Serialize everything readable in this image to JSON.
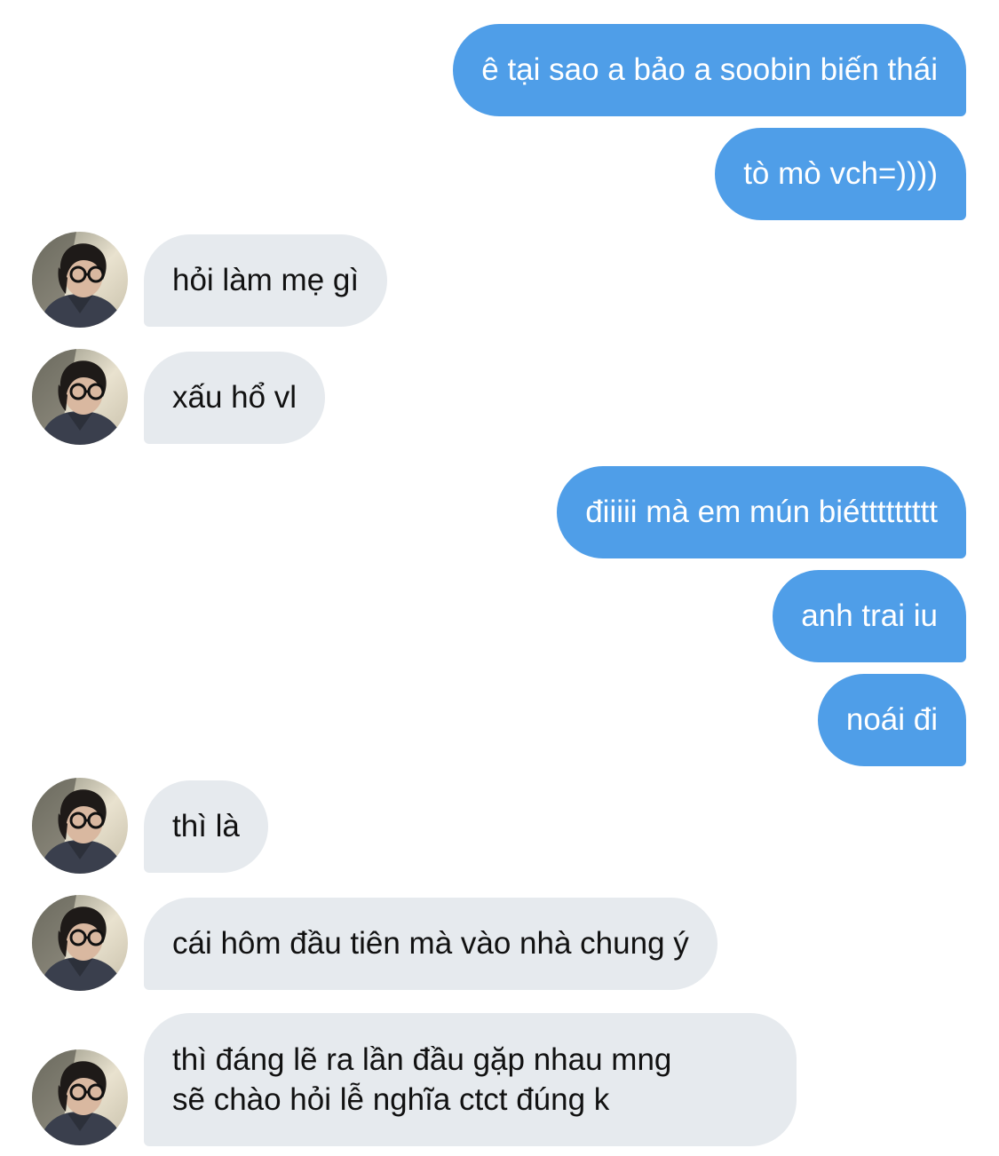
{
  "conversation": {
    "messages": [
      {
        "side": "sent",
        "text": "ê tại sao a bảo a soobin biến thái"
      },
      {
        "side": "sent",
        "text": "tò mò vch=))))"
      },
      {
        "side": "received",
        "text": "hỏi làm mẹ gì"
      },
      {
        "side": "received",
        "text": "xấu hổ vl"
      },
      {
        "side": "sent",
        "text": "điiiii mà em mún biéttttttttt"
      },
      {
        "side": "sent",
        "text": "anh trai iu"
      },
      {
        "side": "sent",
        "text": "noái đi"
      },
      {
        "side": "received",
        "text": "thì là"
      },
      {
        "side": "received",
        "text": "cái hôm đầu tiên mà vào nhà chung ý"
      },
      {
        "side": "received",
        "line1": "thì đáng lẽ ra lần đầu gặp nhau mng",
        "line2": "sẽ chào hỏi lễ nghĩa ctct đúng k"
      }
    ]
  },
  "colors": {
    "sent_bubble": "#4f9ee8",
    "received_bubble": "#e6eaee",
    "background": "#ffffff"
  },
  "icons": {
    "avatar": "contact-avatar-photo"
  }
}
